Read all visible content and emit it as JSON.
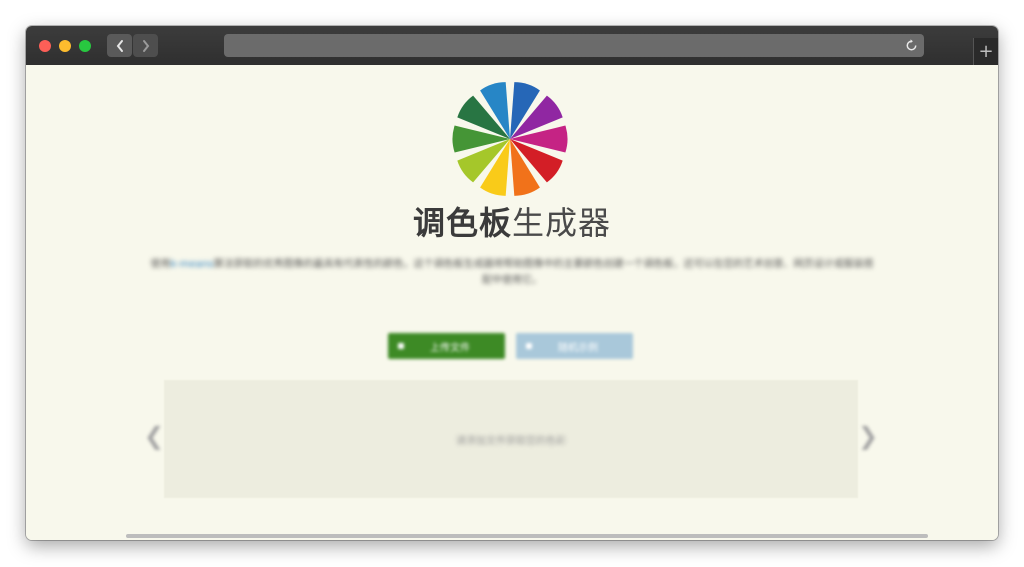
{
  "window": {
    "new_tab_symbol": "+"
  },
  "page": {
    "title_bold": "调色板",
    "title_light": "生成器",
    "description_link": "k-means",
    "description_before": "使用",
    "description_after": "算法获取的优秀图像的最具有代表性的颜色，这个调色板生成器将帮助图像中的主要颜色创建一个调色板，还可以在您的艺术创意、网页设计或服装搭配中使用它。",
    "primary_button_label": "上传文件",
    "secondary_button_label": "随机示例",
    "carousel_hint": "请添加文件获取您的色彩",
    "arrow_left": "❮",
    "arrow_right": "❯"
  },
  "colors": {
    "primary_button": "#3d8a25",
    "secondary_button": "#a9c8da",
    "page_background": "#f8f8ec"
  },
  "icons": {
    "back": "chevron-left-icon",
    "forward": "chevron-right-icon",
    "reload": "reload-icon",
    "new_tab": "plus-icon"
  }
}
